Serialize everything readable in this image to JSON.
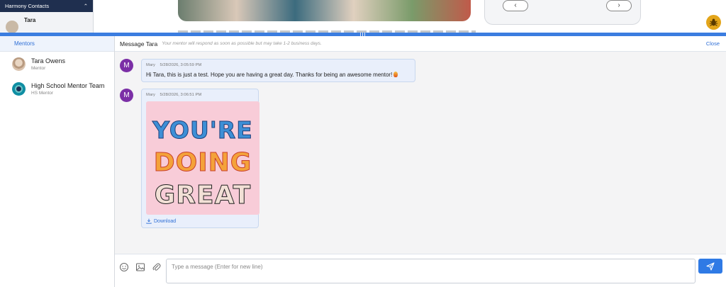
{
  "background": {
    "contacts_header": "Harmony Contacts",
    "contact_name": "Tara"
  },
  "sidebar": {
    "header": "Mentors",
    "mentors": [
      {
        "name": "Tara Owens",
        "role": "Mentor",
        "avatar": "photo-avatar"
      },
      {
        "name": "High School Mentor Team",
        "role": "HS Mentor",
        "avatar": "logo-avatar"
      }
    ]
  },
  "chat": {
    "title": "Message Tara",
    "note": "Your mentor will respond as soon as possible but may take 1-2 business days.",
    "close_label": "Close",
    "messages": [
      {
        "initial": "M",
        "sender": "Mary",
        "timestamp": "5/28/2026, 3:05:59 PM",
        "text": "Hi Tara, this is just a test.  Hope you are having a great day.  Thanks for being an awesome mentor!"
      },
      {
        "initial": "M",
        "sender": "Mary",
        "timestamp": "5/28/2026, 3:06:51 PM",
        "image_text": [
          "YOU'RE",
          "DOING",
          "GREAT"
        ],
        "download_label": "Download"
      }
    ]
  },
  "composer": {
    "placeholder": "Type a message (Enter for new line)",
    "icons": [
      "emoji-icon",
      "image-icon",
      "attachment-icon"
    ],
    "send_icon": "send-icon"
  },
  "colors": {
    "accent": "#2f7ae5",
    "splitter": "#3b7de0",
    "avatar_m": "#7b2fa6",
    "bubble": "#e9effb",
    "sticker_bg": "#f8ccd8",
    "contacts_header": "#1f2f4f"
  }
}
